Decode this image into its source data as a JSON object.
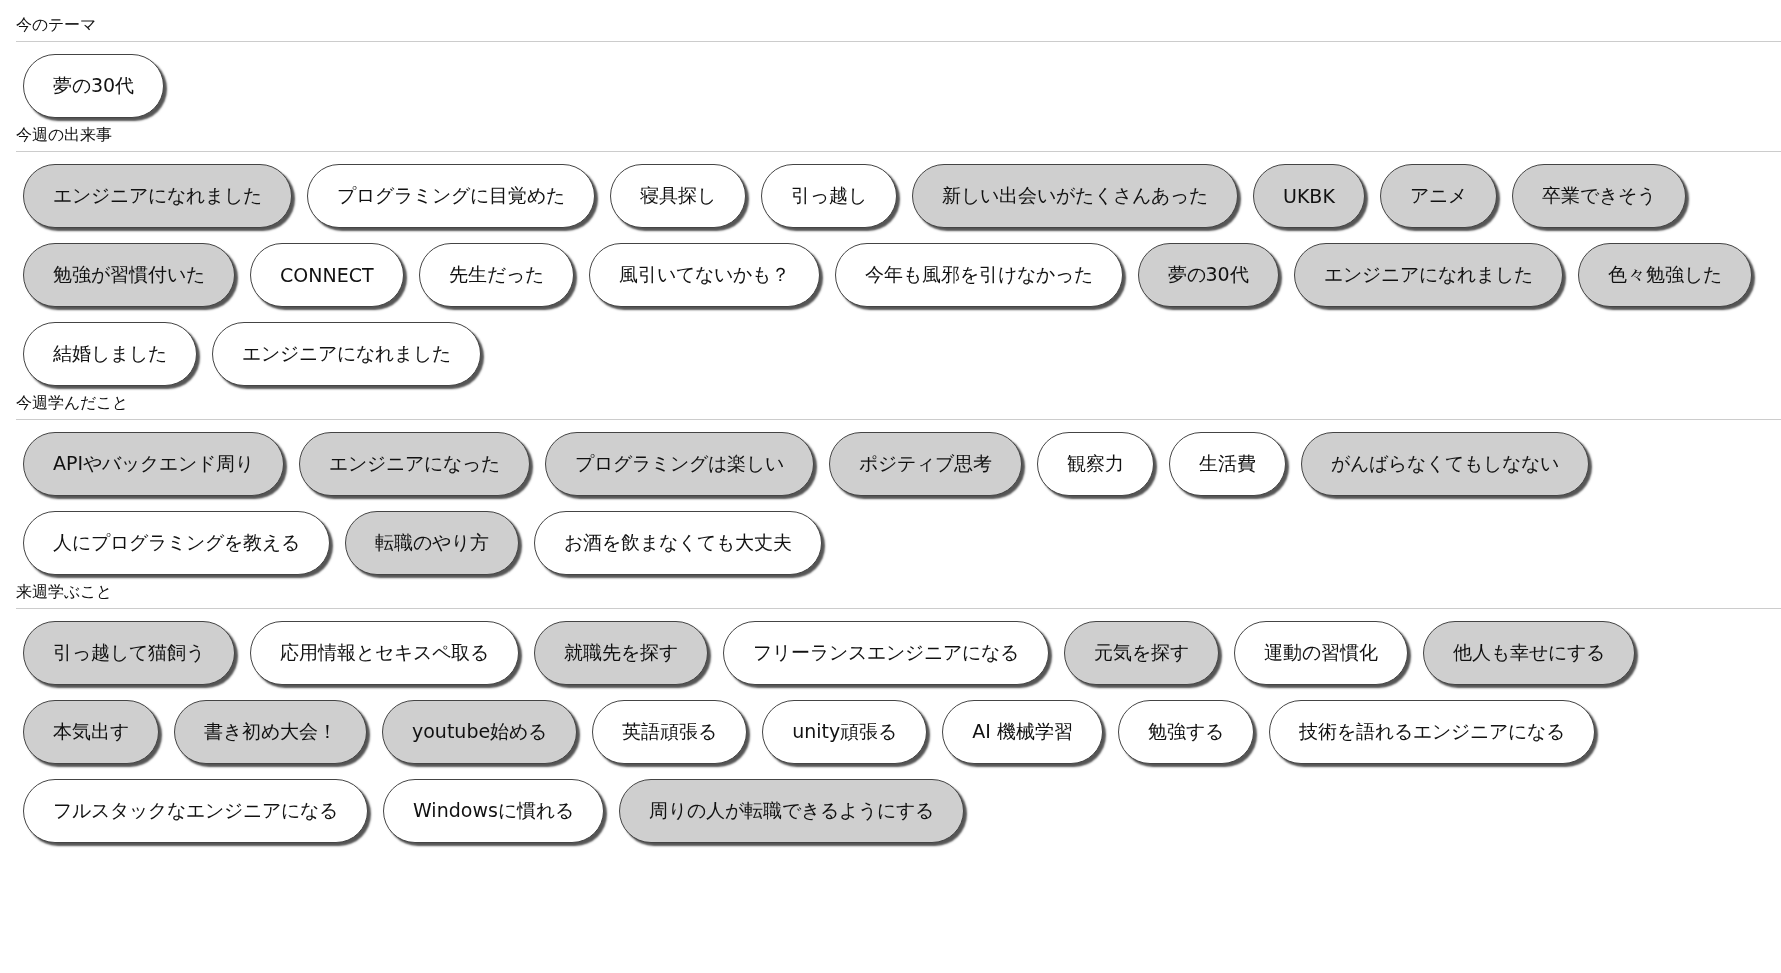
{
  "sections": [
    {
      "title": "今のテーマ",
      "chips": [
        {
          "label": "夢の30代",
          "selected": false
        }
      ]
    },
    {
      "title": "今週の出来事",
      "chips": [
        {
          "label": "エンジニアになれました",
          "selected": true
        },
        {
          "label": "プログラミングに目覚めた",
          "selected": false
        },
        {
          "label": "寝具探し",
          "selected": false
        },
        {
          "label": "引っ越し",
          "selected": false
        },
        {
          "label": "新しい出会いがたくさんあった",
          "selected": true
        },
        {
          "label": "UKBK",
          "selected": true
        },
        {
          "label": "アニメ",
          "selected": true
        },
        {
          "label": "卒業できそう",
          "selected": true
        },
        {
          "label": "勉強が習慣付いた",
          "selected": true
        },
        {
          "label": "CONNECT",
          "selected": false
        },
        {
          "label": "先生だった",
          "selected": false
        },
        {
          "label": "風引いてないかも？",
          "selected": false
        },
        {
          "label": "今年も風邪を引けなかった",
          "selected": false
        },
        {
          "label": "夢の30代",
          "selected": true
        },
        {
          "label": "エンジニアになれました",
          "selected": true
        },
        {
          "label": "色々勉強した",
          "selected": true
        },
        {
          "label": "結婚しました",
          "selected": false
        },
        {
          "label": "エンジニアになれました",
          "selected": false
        }
      ]
    },
    {
      "title": "今週学んだこと",
      "chips": [
        {
          "label": "APIやバックエンド周り",
          "selected": true
        },
        {
          "label": "エンジニアになった",
          "selected": true
        },
        {
          "label": "プログラミングは楽しい",
          "selected": true
        },
        {
          "label": "ポジティブ思考",
          "selected": true
        },
        {
          "label": "観察力",
          "selected": false
        },
        {
          "label": "生活費",
          "selected": false
        },
        {
          "label": "がんばらなくてもしなない",
          "selected": true
        },
        {
          "label": "人にプログラミングを教える",
          "selected": false
        },
        {
          "label": "転職のやり方",
          "selected": true
        },
        {
          "label": "お酒を飲まなくても大丈夫",
          "selected": false
        }
      ]
    },
    {
      "title": "来週学ぶこと",
      "chips": [
        {
          "label": "引っ越して猫飼う",
          "selected": true
        },
        {
          "label": "応用情報とセキスペ取る",
          "selected": false
        },
        {
          "label": "就職先を探す",
          "selected": true
        },
        {
          "label": "フリーランスエンジニアになる",
          "selected": false
        },
        {
          "label": "元気を探す",
          "selected": true
        },
        {
          "label": "運動の習慣化",
          "selected": false
        },
        {
          "label": "他人も幸せにする",
          "selected": true
        },
        {
          "label": "本気出す",
          "selected": true
        },
        {
          "label": "書き初め大会！",
          "selected": true
        },
        {
          "label": "youtube始める",
          "selected": true
        },
        {
          "label": "英語頑張る",
          "selected": false
        },
        {
          "label": "unity頑張る",
          "selected": false
        },
        {
          "label": "AI 機械学習",
          "selected": false
        },
        {
          "label": "勉強する",
          "selected": false
        },
        {
          "label": "技術を語れるエンジニアになる",
          "selected": false
        },
        {
          "label": "フルスタックなエンジニアになる",
          "selected": false
        },
        {
          "label": "Windowsに慣れる",
          "selected": false
        },
        {
          "label": "周りの人が転職できるようにする",
          "selected": true
        }
      ]
    }
  ]
}
